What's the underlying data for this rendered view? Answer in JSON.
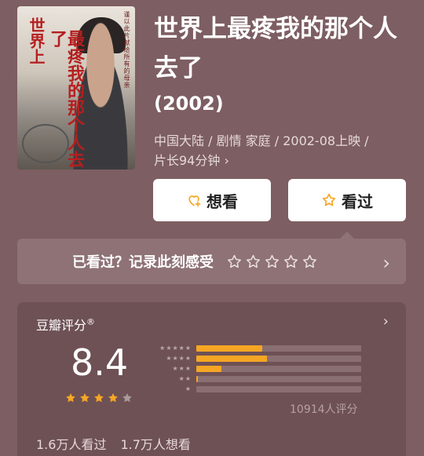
{
  "movie": {
    "title": "世界上最疼我的那个人去了",
    "year": "(2002)",
    "meta_line1": "中国大陆 / 剧情 家庭 / 2002-08上映 /",
    "meta_line2": "片长94分钟 ›"
  },
  "poster": {
    "calligraphy_1": "世界上",
    "calligraphy_2": "最疼我的那个人去了",
    "tagline": "谨以此片献给所有的母亲"
  },
  "actions": {
    "want_label": "想看",
    "seen_label": "看过"
  },
  "record": {
    "prompt": "已看过？记录此刻感受",
    "star_count": 5
  },
  "rating": {
    "label": "豆瓣评分",
    "label_mark": "®",
    "score": "8.4",
    "stars": 4,
    "distribution": [
      0.4,
      0.43,
      0.15,
      0.01,
      0.0
    ],
    "count": "10914人评分",
    "watched": "1.6万人看过",
    "wanted": "1.7万人想看"
  },
  "colors": {
    "background": "#7d5e62",
    "accent": "#f5a623"
  },
  "icons": [
    "heart-plus-icon",
    "star-outline-icon",
    "chevron-right-icon"
  ]
}
